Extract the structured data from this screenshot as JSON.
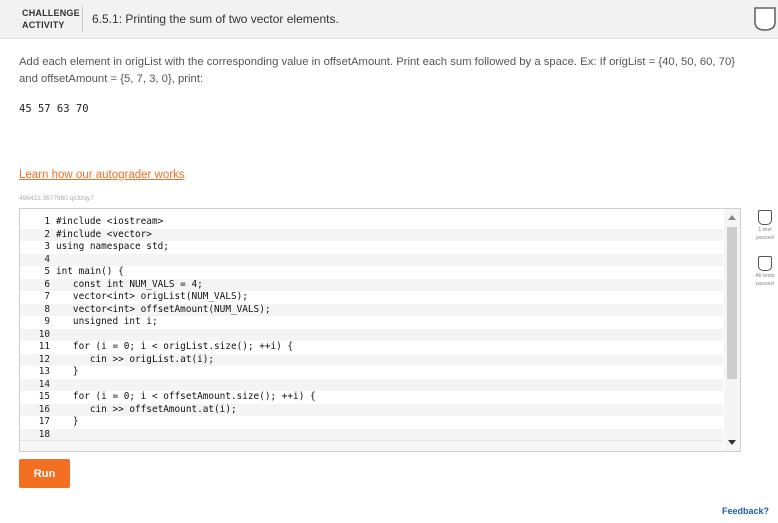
{
  "header": {
    "badge_line1": "CHALLENGE",
    "badge_line2": "ACTIVITY",
    "title": "6.5.1: Printing the sum of two vector elements."
  },
  "prompt": {
    "text": "Add each element in origList with the corresponding value in offsetAmount. Print each sum followed by a space. Ex: If origList = {40, 50, 60, 70} and offsetAmount = {5, 7, 3, 0}, print:",
    "example_output": "45 57 63 70"
  },
  "learn_link": "Learn how our autograder works",
  "file_id": "496422.3677980.qx3zqy7",
  "editor": {
    "lines": [
      {
        "n": "1",
        "code": "#include <iostream>"
      },
      {
        "n": "2",
        "code": "#include <vector>"
      },
      {
        "n": "3",
        "code": "using namespace std;"
      },
      {
        "n": "4",
        "code": ""
      },
      {
        "n": "5",
        "code": "int main() {"
      },
      {
        "n": "6",
        "code": "   const int NUM_VALS = 4;"
      },
      {
        "n": "7",
        "code": "   vector<int> origList(NUM_VALS);"
      },
      {
        "n": "8",
        "code": "   vector<int> offsetAmount(NUM_VALS);"
      },
      {
        "n": "9",
        "code": "   unsigned int i;"
      },
      {
        "n": "10",
        "code": ""
      },
      {
        "n": "11",
        "code": "   for (i = 0; i < origList.size(); ++i) {"
      },
      {
        "n": "12",
        "code": "      cin >> origList.at(i);"
      },
      {
        "n": "13",
        "code": "   }"
      },
      {
        "n": "14",
        "code": ""
      },
      {
        "n": "15",
        "code": "   for (i = 0; i < offsetAmount.size(); ++i) {"
      },
      {
        "n": "16",
        "code": "      cin >> offsetAmount.at(i);"
      },
      {
        "n": "17",
        "code": "   }"
      },
      {
        "n": "18",
        "code": ""
      }
    ]
  },
  "run_label": "Run",
  "tests": [
    {
      "label_line1": "1 test",
      "label_line2": "passed"
    },
    {
      "label_line1": "All tests",
      "label_line2": "passed"
    }
  ],
  "feedback_label": "Feedback?",
  "colors": {
    "accent": "#f36f21",
    "link_blue": "#1a5fa8"
  }
}
